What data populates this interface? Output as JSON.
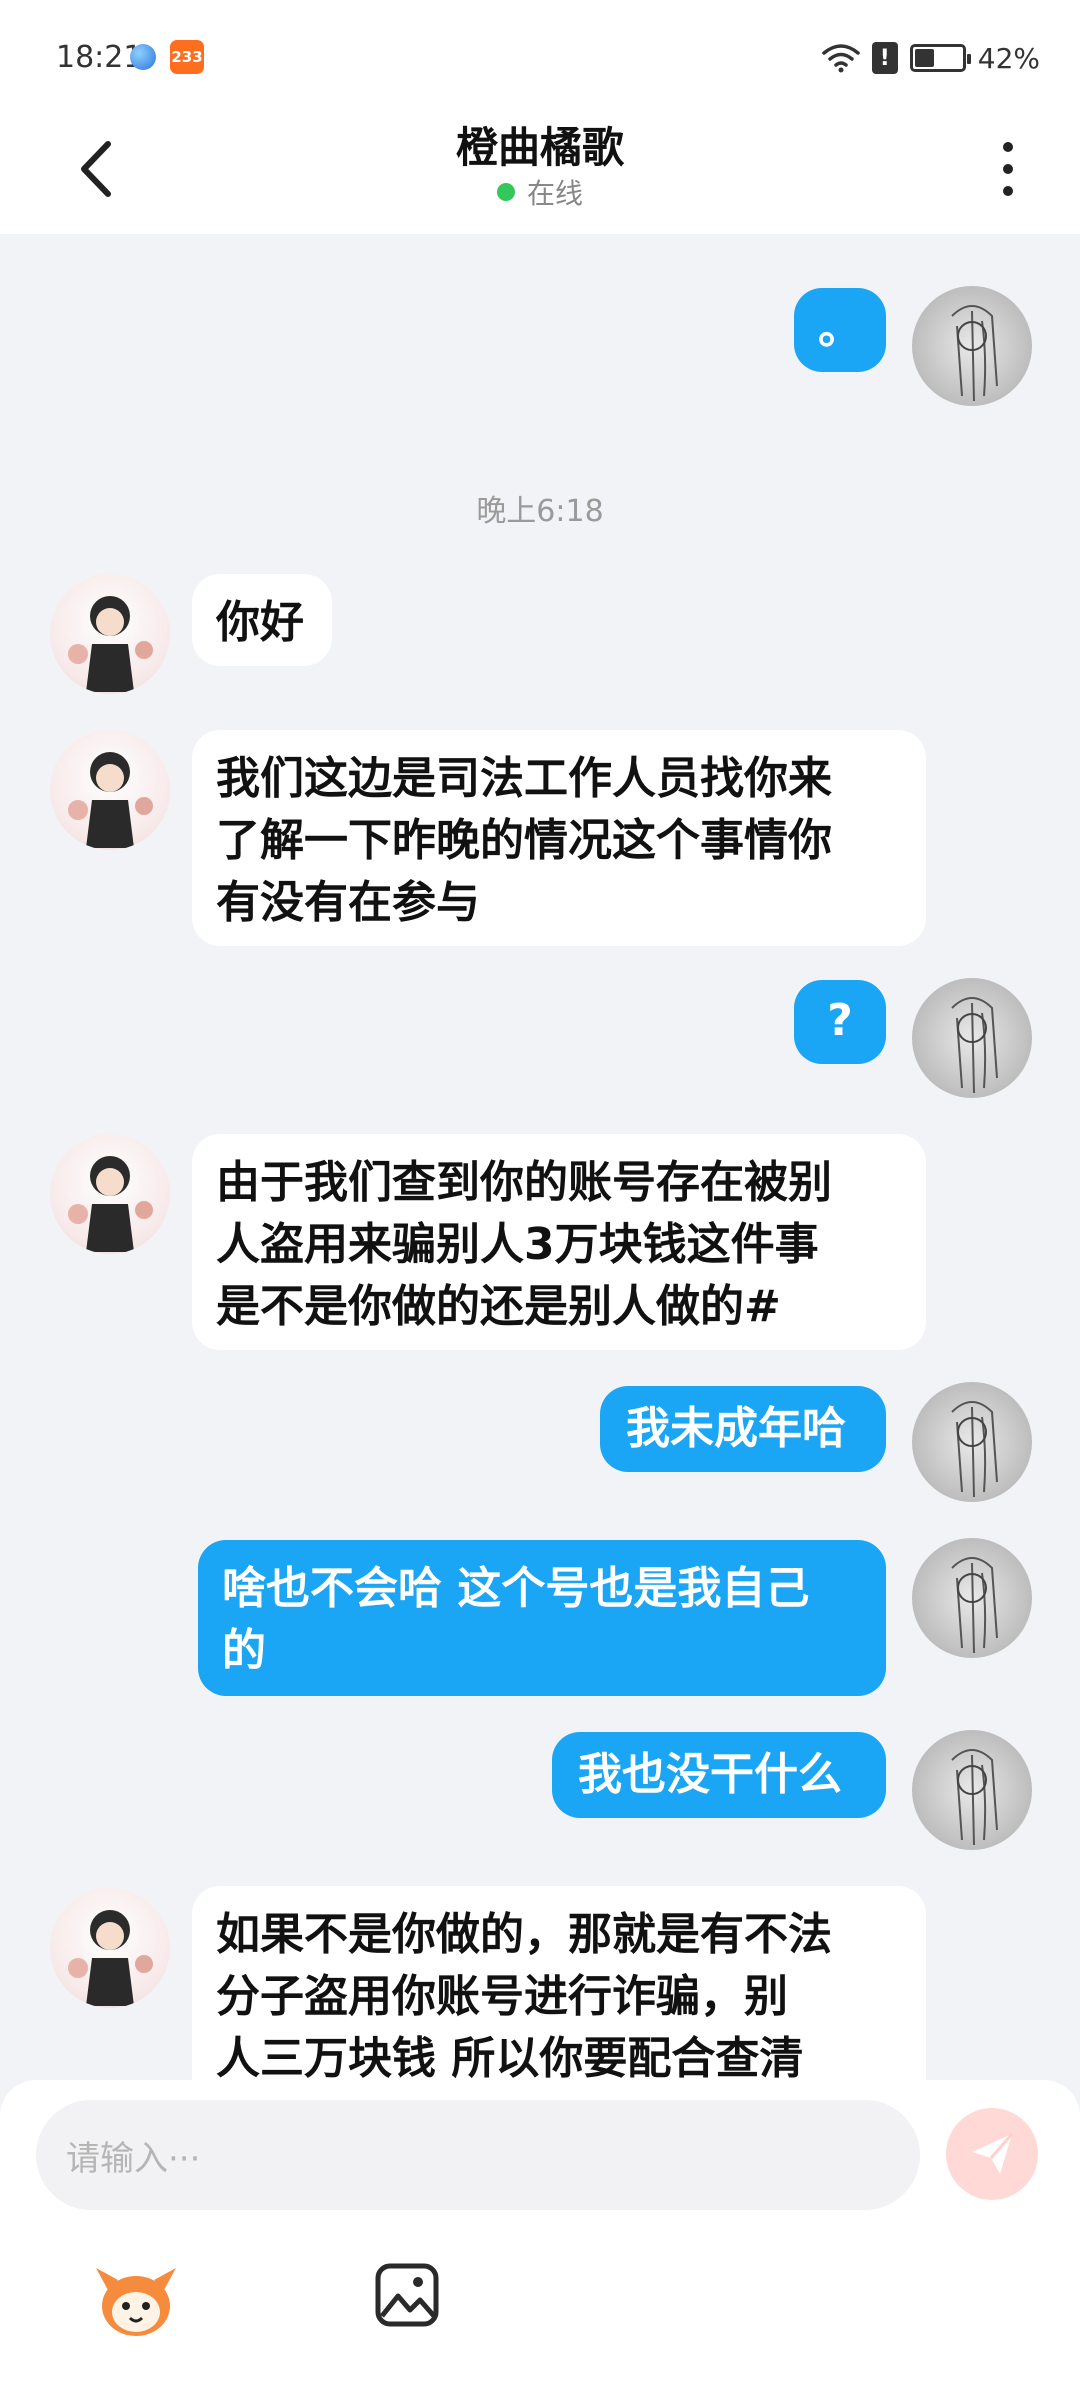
{
  "status_bar": {
    "time": "18:21",
    "badge": "233",
    "alert": "!",
    "battery": "42%",
    "battery_level": 0.42
  },
  "header": {
    "title": "橙曲橘歌",
    "status": "在线"
  },
  "chat": {
    "time_separator": "晚上6:18",
    "messages": [
      {
        "side": "out",
        "text": "。"
      },
      {
        "side": "in",
        "text": "你好"
      },
      {
        "side": "in",
        "lines": [
          "我们这边是司法工作人员找你来",
          "了解一下昨晚的情况这个事情你",
          "有没有在参与"
        ]
      },
      {
        "side": "out",
        "text": "?"
      },
      {
        "side": "in",
        "lines": [
          "由于我们查到你的账号存在被别",
          "人盗用来骗别人3万块钱这件事",
          "是不是你做的还是别人做的#"
        ]
      },
      {
        "side": "out",
        "text": "我未成年哈"
      },
      {
        "side": "out",
        "lines": [
          "啥也不会哈 这个号也是我自己",
          "的"
        ]
      },
      {
        "side": "out",
        "text": "我也没干什么"
      },
      {
        "side": "in",
        "lines": [
          "如果不是你做的，那就是有不法",
          "分子盗用你账号进行诈骗，别",
          "人三万块钱 所以你要配合查清"
        ]
      }
    ]
  },
  "input": {
    "placeholder": "请输入···"
  },
  "icons": {
    "back": "chevron-left-icon",
    "more": "more-vertical-icon",
    "send": "send-icon",
    "mascot": "mascot-icon",
    "image": "image-icon"
  },
  "colors": {
    "bubble_out": "#1aa5f5",
    "bubble_in": "#ffffff",
    "background": "#f2f3f6",
    "online": "#34c759",
    "send_button": "#ffd9d6"
  }
}
